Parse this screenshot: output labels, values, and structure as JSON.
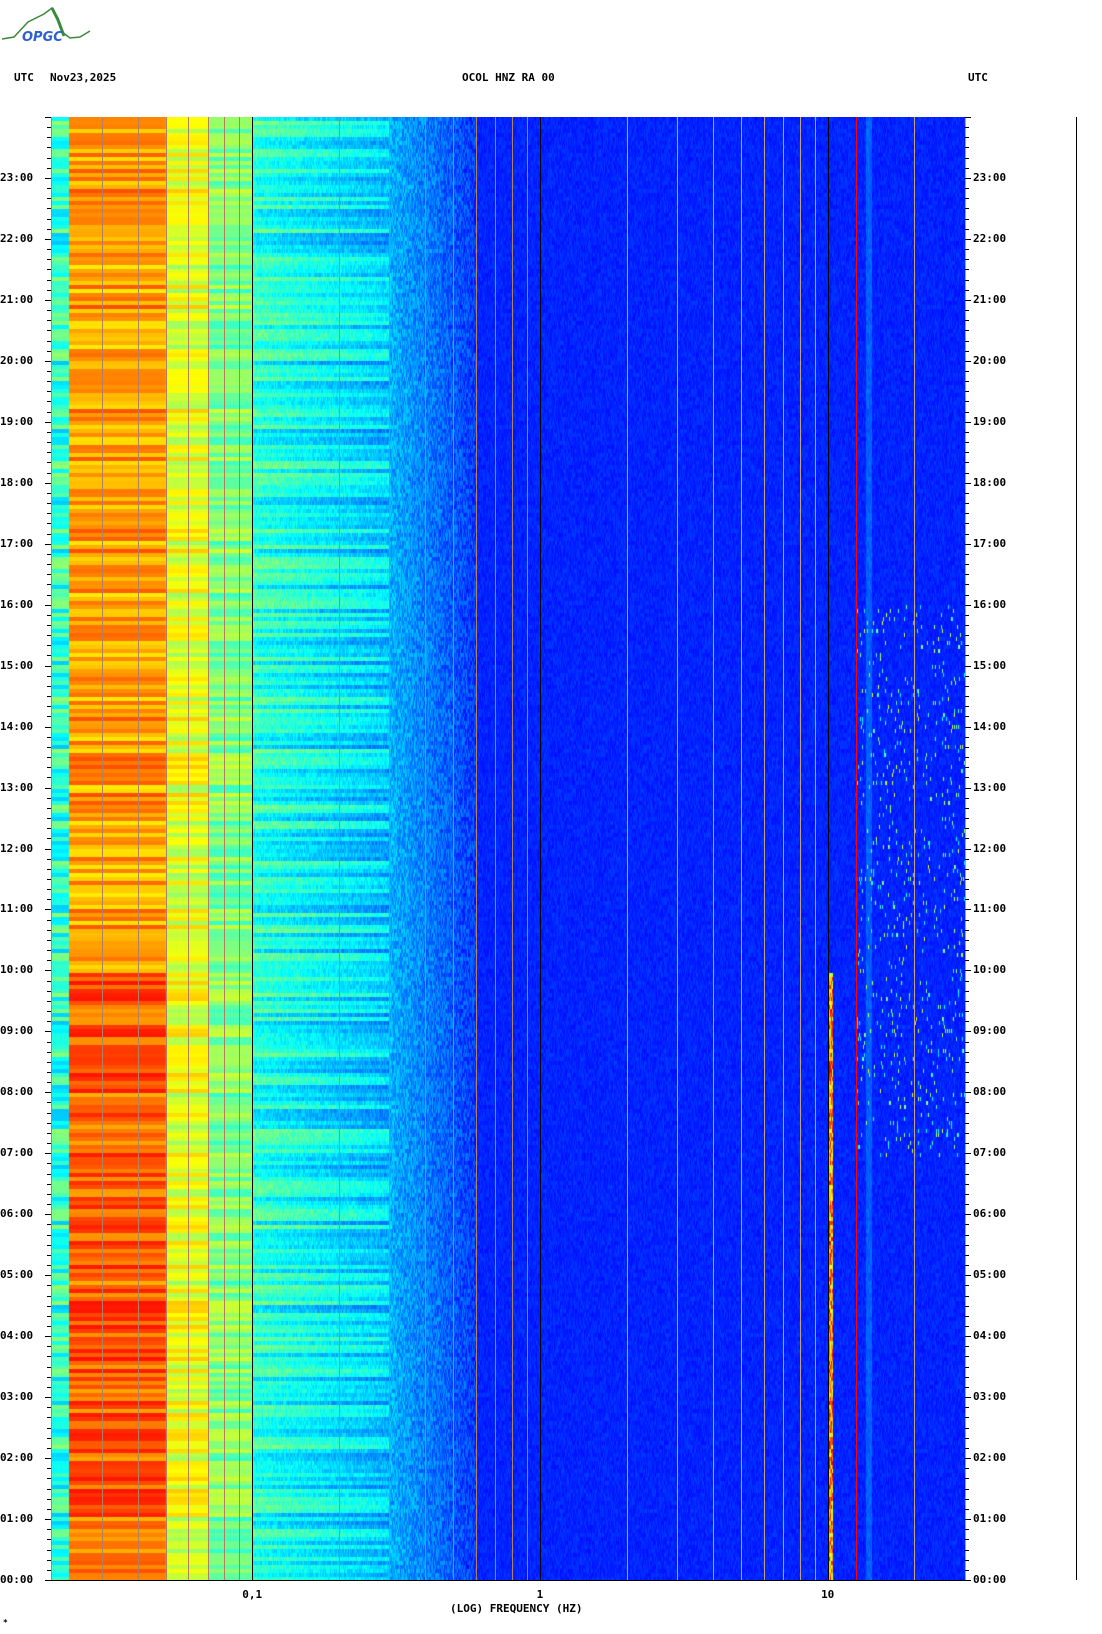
{
  "header": {
    "left_tz": "UTC",
    "date": "Nov23,2025",
    "station": "OCOL HNZ RA 00",
    "right_tz": "UTC"
  },
  "logo": {
    "text": "OPGC"
  },
  "footer_mark": "*",
  "chart_data": {
    "type": "heatmap",
    "title": "OCOL HNZ RA 00",
    "xlabel": "(LOG) FREQUENCY (HZ)",
    "ylabel": "UTC",
    "x_scale": "log",
    "xlim": [
      0.02,
      30
    ],
    "ylim_hours": [
      0,
      24
    ],
    "x_tick_labels": [
      {
        "value": 0.1,
        "label": "0,1"
      },
      {
        "value": 1,
        "label": "1"
      },
      {
        "value": 10,
        "label": "10"
      }
    ],
    "y_tick_labels": [
      "00:00",
      "01:00",
      "02:00",
      "03:00",
      "04:00",
      "05:00",
      "06:00",
      "07:00",
      "08:00",
      "09:00",
      "10:00",
      "11:00",
      "12:00",
      "13:00",
      "14:00",
      "15:00",
      "16:00",
      "17:00",
      "18:00",
      "19:00",
      "20:00",
      "21:00",
      "22:00",
      "23:00"
    ],
    "minor_tick_minutes": 10,
    "colormap": "jet",
    "marker_line_hz": 12.5,
    "marker_line_color": "#ff0000",
    "description_bands": [
      {
        "from_hz": 0.023,
        "to_hz": 0.05,
        "level": "high"
      },
      {
        "from_hz": 0.05,
        "to_hz": 0.3,
        "level": "medium"
      },
      {
        "from_hz": 0.5,
        "to_hz": 30,
        "level": "low"
      },
      {
        "from_hz": 10.1,
        "to_hz": 10.4,
        "level": "peak",
        "hours": [
          0,
          10
        ]
      }
    ]
  }
}
